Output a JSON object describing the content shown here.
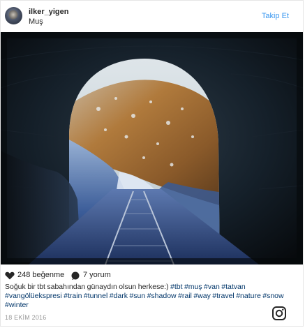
{
  "header": {
    "username": "ilker_yigen",
    "location": "Muş",
    "follow_label": "Takip Et"
  },
  "stats": {
    "likes_label": "248 beğenme",
    "comments_label": "7 yorum"
  },
  "caption": {
    "text": "Soğuk bir tbt sabahından günaydın olsun herkese:)",
    "hashtags": [
      "#tbt",
      "#muş",
      "#van",
      "#tatvan",
      "#vangölüekspresi",
      "#train",
      "#tunnel",
      "#dark",
      "#sun",
      "#shadow",
      "#rail",
      "#way",
      "#travel",
      "#nature",
      "#snow",
      "#winter"
    ]
  },
  "date": "18 EKİM 2016",
  "colors": {
    "link": "#3897f0",
    "hashtag": "#003569",
    "text": "#262626",
    "muted": "#999999"
  },
  "icons": {
    "heart": "heart-icon",
    "comment": "comment-icon",
    "brand": "instagram-logo-icon"
  }
}
